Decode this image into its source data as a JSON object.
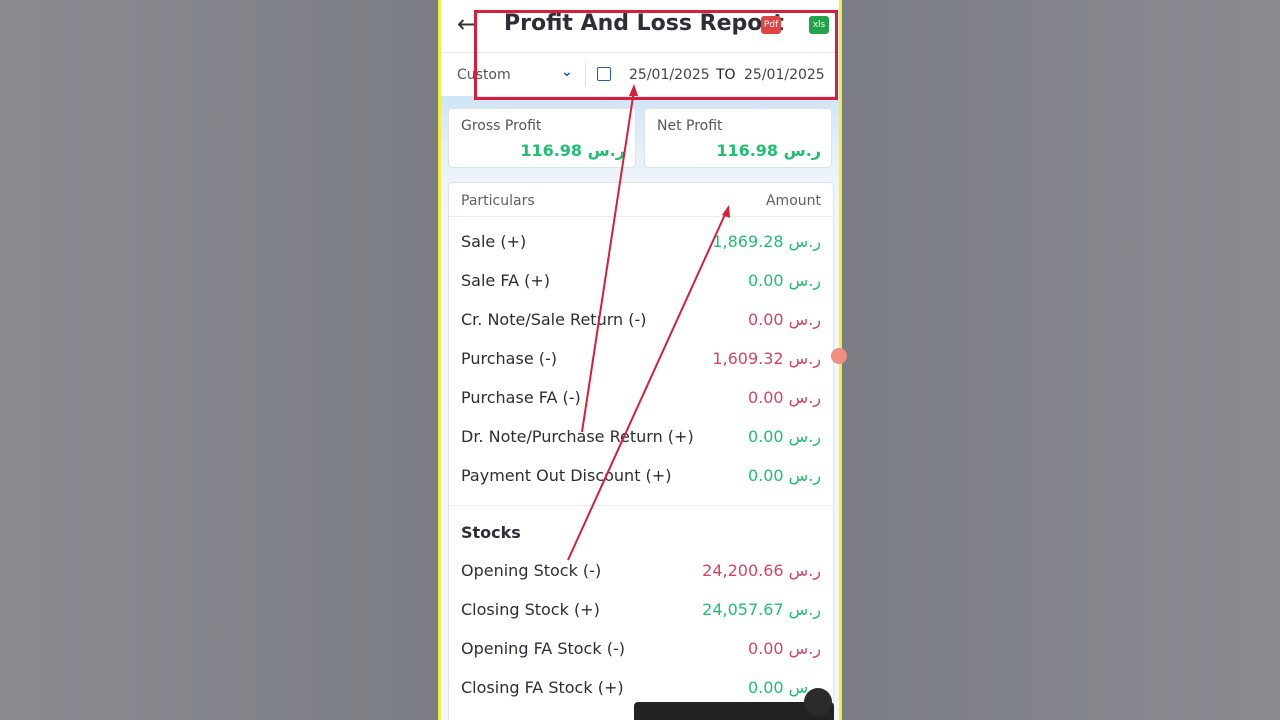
{
  "header": {
    "back_icon": "arrow-left-icon",
    "title": "Profit And Loss Report",
    "pdf_label": "Pdf",
    "xls_label": "xls"
  },
  "filter": {
    "period": "Custom",
    "from_date": "25/01/2025",
    "to_label": "TO",
    "to_date": "25/01/2025"
  },
  "summary": {
    "gross_label": "Gross Profit",
    "gross_value": "116.98 ر.س",
    "net_label": "Net Profit",
    "net_value": "116.98 ر.س"
  },
  "table": {
    "col_particulars": "Particulars",
    "col_amount": "Amount",
    "rows": [
      {
        "name": "Sale (+)",
        "amount": "1,869.28 ر.س",
        "color": "#1fbf72"
      },
      {
        "name": "Sale FA (+)",
        "amount": "0.00 ر.س",
        "color": "#1fbf72"
      },
      {
        "name": "Cr. Note/Sale Return (-)",
        "amount": "0.00 ر.س",
        "color": "#d44565"
      },
      {
        "name": "Purchase (-)",
        "amount": "1,609.32 ر.س",
        "color": "#d44565"
      },
      {
        "name": "Purchase FA (-)",
        "amount": "0.00 ر.س",
        "color": "#d44565"
      },
      {
        "name": "Dr. Note/Purchase Return (+)",
        "amount": "0.00 ر.س",
        "color": "#1fbf72"
      },
      {
        "name": "Payment Out Discount (+)",
        "amount": "0.00 ر.س",
        "color": "#1fbf72"
      }
    ],
    "stocks_heading": "Stocks",
    "stock_rows": [
      {
        "name": "Opening Stock (-)",
        "amount": "24,200.66 ر.س",
        "color": "#d44565"
      },
      {
        "name": "Closing Stock (+)",
        "amount": "24,057.67 ر.س",
        "color": "#1fbf72"
      },
      {
        "name": "Opening FA Stock (-)",
        "amount": "0.00 ر.س",
        "color": "#d44565"
      },
      {
        "name": "Closing FA Stock (+)",
        "amount": "0.00 ر.س",
        "color": "#1fbf72"
      }
    ]
  },
  "colors": {
    "positive": "#1fbf72",
    "negative": "#d44565",
    "annotation": "#d61f3a",
    "accent": "#1e5fb5"
  }
}
